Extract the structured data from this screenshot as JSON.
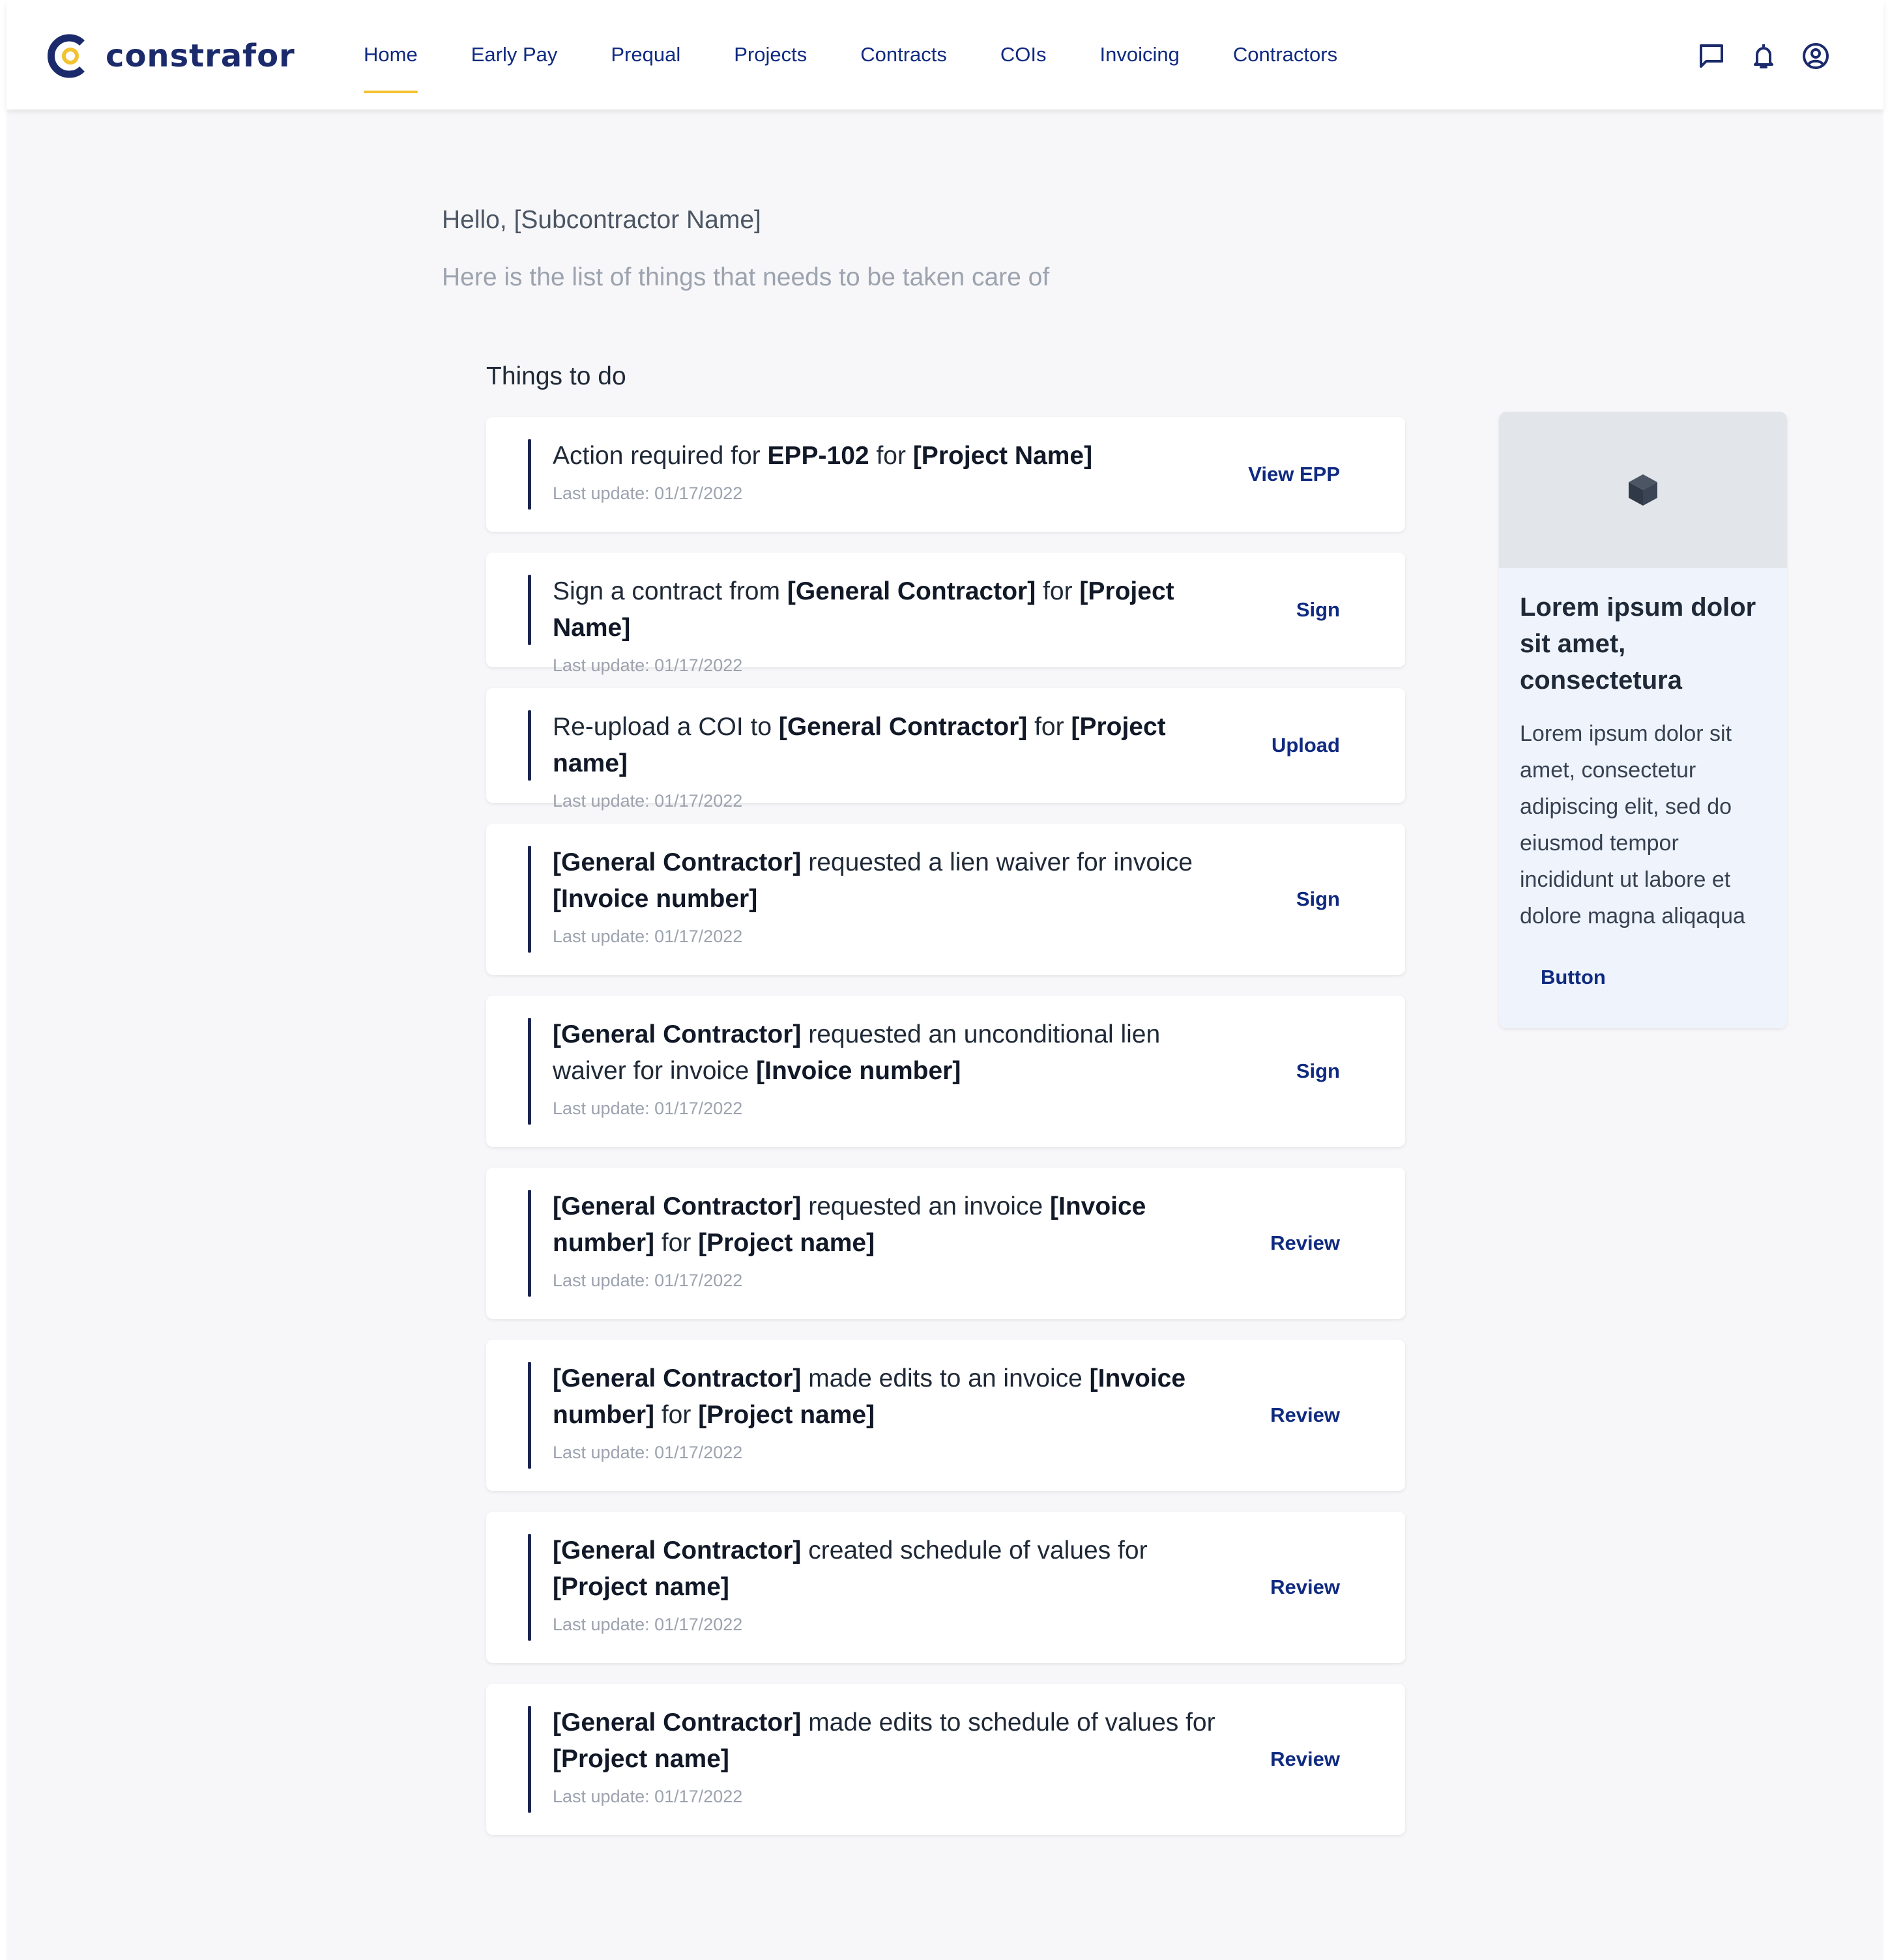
{
  "app": {
    "name": "constrafor"
  },
  "nav": {
    "items": [
      {
        "label": "Home",
        "active": true
      },
      {
        "label": "Early Pay"
      },
      {
        "label": "Prequal"
      },
      {
        "label": "Projects"
      },
      {
        "label": "Contracts"
      },
      {
        "label": "COIs"
      },
      {
        "label": "Invoicing"
      },
      {
        "label": "Contractors"
      }
    ]
  },
  "header_icons": [
    "chat-icon",
    "bell-icon",
    "user-account-icon"
  ],
  "greeting": "Hello, [Subcontractor Name]",
  "subtitle": "Here is the list of things that needs to be taken care of",
  "todo": {
    "heading": "Things to do",
    "tasks": [
      {
        "parts": [
          [
            "Action required for ",
            false
          ],
          [
            "EPP-102",
            true
          ],
          [
            " for ",
            false
          ],
          [
            "[Project Name]",
            true
          ]
        ],
        "updated": "Last update: 01/17/2022",
        "action": "View EPP"
      },
      {
        "parts": [
          [
            "Sign a contract from ",
            false
          ],
          [
            "[General Contractor]",
            true
          ],
          [
            " for ",
            false
          ],
          [
            "[Project Name]",
            true
          ]
        ],
        "updated": "Last update: 01/17/2022",
        "action": "Sign"
      },
      {
        "parts": [
          [
            "Re-upload a COI to ",
            false
          ],
          [
            "[General Contractor]",
            true
          ],
          [
            " for ",
            false
          ],
          [
            "[Project name]",
            true
          ]
        ],
        "updated": "Last update: 01/17/2022",
        "action": "Upload"
      },
      {
        "parts": [
          [
            "[General Contractor]",
            true
          ],
          [
            " requested a lien waiver for invoice ",
            false
          ],
          [
            "[Invoice number]",
            true
          ]
        ],
        "updated": "Last update: 01/17/2022",
        "action": "Sign"
      },
      {
        "parts": [
          [
            "[General Contractor]",
            true
          ],
          [
            " requested an unconditional lien waiver for invoice ",
            false
          ],
          [
            "[Invoice number]",
            true
          ]
        ],
        "updated": "Last update: 01/17/2022",
        "action": "Sign"
      },
      {
        "parts": [
          [
            "[General Contractor]",
            true
          ],
          [
            " requested an invoice ",
            false
          ],
          [
            "[Invoice number]",
            true
          ],
          [
            " for ",
            false
          ],
          [
            "[Project name]",
            true
          ]
        ],
        "updated": "Last update: 01/17/2022",
        "action": "Review"
      },
      {
        "parts": [
          [
            "[General Contractor]",
            true
          ],
          [
            " made edits to an invoice ",
            false
          ],
          [
            "[Invoice number]",
            true
          ],
          [
            " for ",
            false
          ],
          [
            "[Project name]",
            true
          ]
        ],
        "updated": "Last update: 01/17/2022",
        "action": "Review"
      },
      {
        "parts": [
          [
            "[General Contractor]",
            true
          ],
          [
            " created schedule of values for ",
            false
          ],
          [
            "[Project name]",
            true
          ]
        ],
        "updated": "Last update: 01/17/2022",
        "action": "Review"
      },
      {
        "parts": [
          [
            "[General Contractor]",
            true
          ],
          [
            " made edits to schedule of values for ",
            false
          ],
          [
            "[Project name]",
            true
          ]
        ],
        "updated": "Last update: 01/17/2022",
        "action": "Review"
      }
    ]
  },
  "promo": {
    "image_icon": "cube-icon",
    "title": "Lorem ipsum dolor sit amet, consectetura",
    "body": "Lorem ipsum dolor sit amet, consectetur adipiscing elit, sed do eiusmod tempor incididunt ut labore et dolore magna aliqaqua",
    "button": "Button"
  },
  "colors": {
    "brand_navy": "#1b2a6b",
    "link_blue": "#0f2a80",
    "accent_yellow": "#f2c230",
    "page_bg": "#f7f7f9",
    "promo_bg": "#eff4fc"
  }
}
